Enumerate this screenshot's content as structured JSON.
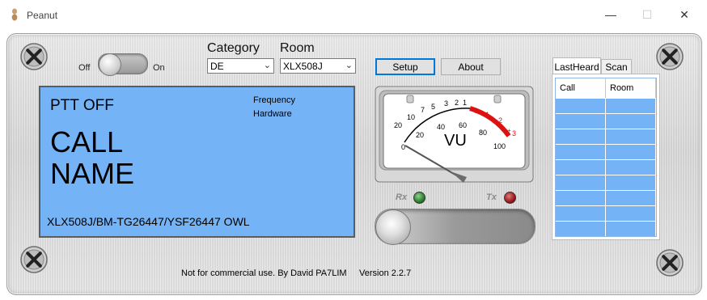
{
  "window": {
    "title": "Peanut",
    "minimize": "—",
    "maximize": "☐",
    "close": "✕"
  },
  "power": {
    "off_label": "Off",
    "on_label": "On",
    "state": "off"
  },
  "category": {
    "label": "Category",
    "value": "DE"
  },
  "room": {
    "label": "Room",
    "value": "XLX508J"
  },
  "buttons": {
    "setup": "Setup",
    "about": "About"
  },
  "display": {
    "ptt_status": "PTT OFF",
    "frequency_label": "Frequency",
    "hardware_label": "Hardware",
    "call": "CALL",
    "name": "NAME",
    "reflector": "XLX508J/BM-TG26447/YSF26447 OWL",
    "background_color": "#75b3f7"
  },
  "vu_meter": {
    "label": "VU",
    "upper_scale": [
      "20",
      "10",
      "7",
      "5",
      "3",
      "2",
      "1",
      "0",
      "1",
      "2",
      "3"
    ],
    "lower_scale": [
      "0",
      "20",
      "40",
      "60",
      "80",
      "100"
    ],
    "plus_sign": "+"
  },
  "indicators": {
    "rx_label": "Rx",
    "tx_label": "Tx",
    "rx_color": "#2e7d2e",
    "tx_color": "#9b1a1a"
  },
  "tabs": {
    "items": [
      "LastHeard",
      "Scan"
    ],
    "active": "LastHeard"
  },
  "lastheard_table": {
    "columns": [
      "Call",
      "Room"
    ],
    "rows": 9
  },
  "footer": {
    "credit": "Not for commercial use. By David PA7LIM",
    "version": "Version 2.2.7"
  }
}
